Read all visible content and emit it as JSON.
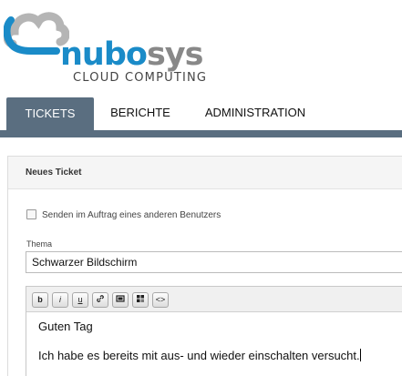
{
  "brand": {
    "name_part1": "nubo",
    "name_part2": "sys",
    "tagline": "CLOUD COMPUTING",
    "colors": {
      "blue": "#1a8bc8",
      "gray": "#888888"
    }
  },
  "nav": {
    "tabs": [
      {
        "label": "TICKETS",
        "active": true
      },
      {
        "label": "BERICHTE",
        "active": false
      },
      {
        "label": "ADMINISTRATION",
        "active": false
      }
    ],
    "accent": "#5a6e80"
  },
  "form": {
    "title": "Neues Ticket",
    "on_behalf_label": "Senden im Auftrag eines anderen Benutzers",
    "on_behalf_checked": false,
    "subject_label": "Thema",
    "subject_value": "Schwarzer Bildschirm",
    "editor": {
      "toolbar": [
        {
          "name": "bold-icon",
          "glyph": "b"
        },
        {
          "name": "italic-icon",
          "glyph": "i"
        },
        {
          "name": "underline-icon",
          "glyph": "u"
        },
        {
          "name": "link-icon",
          "glyph": "🔗"
        },
        {
          "name": "image-icon",
          "glyph": "▣"
        },
        {
          "name": "table-icon",
          "glyph": "▦"
        },
        {
          "name": "code-icon",
          "glyph": "<>"
        }
      ],
      "lines": [
        "Guten Tag",
        "Ich habe es bereits mit aus- und wieder einschalten versucht."
      ]
    }
  }
}
